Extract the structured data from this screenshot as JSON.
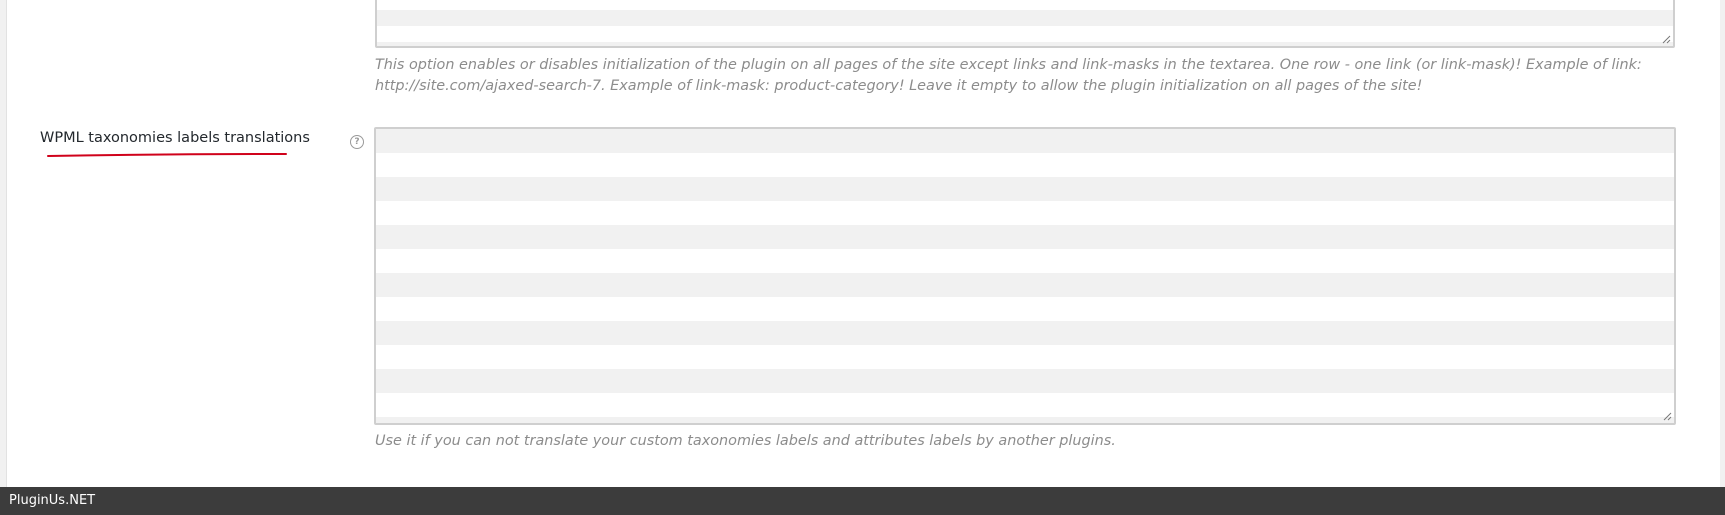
{
  "top_field": {
    "description": "This option enables or disables initialization of the plugin on all pages of the site except links and link-masks in the textarea. One row - one link (or link-mask)! Example of link: http://site.com/ajaxed-search-7. Example of link-mask: product-category! Leave it empty to allow the plugin initialization on all pages of the site!",
    "value": ""
  },
  "wpml_field": {
    "label": "WPML taxonomies labels translations",
    "help_icon": "question-circle-icon",
    "value": "",
    "description": "Use it if you can not translate your custom taxonomies labels and attributes labels by another plugins."
  },
  "footer": {
    "brand": "PluginUs.NET"
  },
  "colors": {
    "underline": "#d0021b",
    "footer_bg": "#3c3c3c",
    "description_text": "#8c8c8c",
    "stripe": "#f1f1f1"
  }
}
